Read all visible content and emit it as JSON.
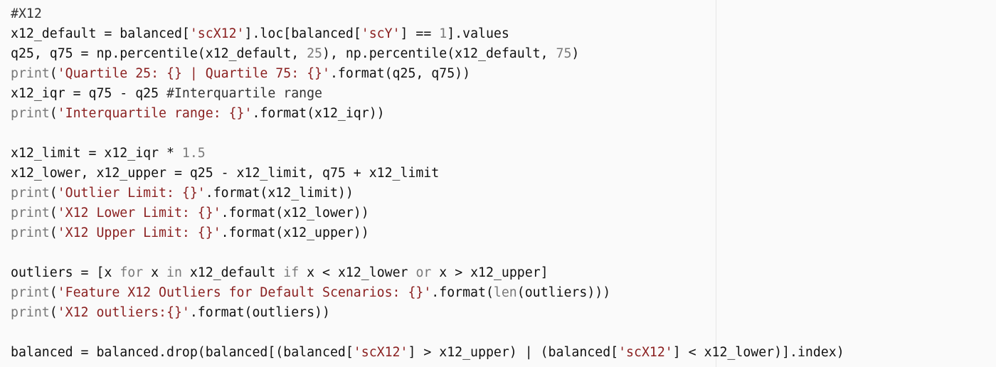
{
  "colors": {
    "background": "#fafafa",
    "plain": "#111111",
    "string": "#8a1f1f",
    "keyword": "#7a7a7a",
    "number": "#7a7a7a",
    "builtin": "#777777",
    "comment": "#333333",
    "ruler": "#e6e6e6"
  },
  "code_lines": [
    [
      {
        "t": "#X12",
        "k": "comment"
      }
    ],
    [
      {
        "t": "x12_default = balanced[",
        "k": "plain"
      },
      {
        "t": "'scX12'",
        "k": "string"
      },
      {
        "t": "].loc[balanced[",
        "k": "plain"
      },
      {
        "t": "'scY'",
        "k": "string"
      },
      {
        "t": "] == ",
        "k": "plain"
      },
      {
        "t": "1",
        "k": "number"
      },
      {
        "t": "].values",
        "k": "plain"
      }
    ],
    [
      {
        "t": "q25, q75 = np.percentile(x12_default, ",
        "k": "plain"
      },
      {
        "t": "25",
        "k": "number"
      },
      {
        "t": "), np.percentile(x12_default, ",
        "k": "plain"
      },
      {
        "t": "75",
        "k": "number"
      },
      {
        "t": ")",
        "k": "plain"
      }
    ],
    [
      {
        "t": "print",
        "k": "builtin"
      },
      {
        "t": "(",
        "k": "plain"
      },
      {
        "t": "'Quartile 25: {} | Quartile 75: {}'",
        "k": "string"
      },
      {
        "t": ".format(q25, q75))",
        "k": "plain"
      }
    ],
    [
      {
        "t": "x12_iqr = q75 - q25 ",
        "k": "plain"
      },
      {
        "t": "#Interquartile range",
        "k": "comment"
      }
    ],
    [
      {
        "t": "print",
        "k": "builtin"
      },
      {
        "t": "(",
        "k": "plain"
      },
      {
        "t": "'Interquartile range: {}'",
        "k": "string"
      },
      {
        "t": ".format(x12_iqr))",
        "k": "plain"
      }
    ],
    [],
    [
      {
        "t": "x12_limit = x12_iqr * ",
        "k": "plain"
      },
      {
        "t": "1.5",
        "k": "number"
      }
    ],
    [
      {
        "t": "x12_lower, x12_upper = q25 - x12_limit, q75 + x12_limit",
        "k": "plain"
      }
    ],
    [
      {
        "t": "print",
        "k": "builtin"
      },
      {
        "t": "(",
        "k": "plain"
      },
      {
        "t": "'Outlier Limit: {}'",
        "k": "string"
      },
      {
        "t": ".format(x12_limit))",
        "k": "plain"
      }
    ],
    [
      {
        "t": "print",
        "k": "builtin"
      },
      {
        "t": "(",
        "k": "plain"
      },
      {
        "t": "'X12 Lower Limit: {}'",
        "k": "string"
      },
      {
        "t": ".format(x12_lower))",
        "k": "plain"
      }
    ],
    [
      {
        "t": "print",
        "k": "builtin"
      },
      {
        "t": "(",
        "k": "plain"
      },
      {
        "t": "'X12 Upper Limit: {}'",
        "k": "string"
      },
      {
        "t": ".format(x12_upper))",
        "k": "plain"
      }
    ],
    [],
    [
      {
        "t": "outliers = [x ",
        "k": "plain"
      },
      {
        "t": "for",
        "k": "keyword"
      },
      {
        "t": " x ",
        "k": "plain"
      },
      {
        "t": "in",
        "k": "keyword"
      },
      {
        "t": " x12_default ",
        "k": "plain"
      },
      {
        "t": "if",
        "k": "keyword"
      },
      {
        "t": " x < x12_lower ",
        "k": "plain"
      },
      {
        "t": "or",
        "k": "keyword"
      },
      {
        "t": " x > x12_upper]",
        "k": "plain"
      }
    ],
    [
      {
        "t": "print",
        "k": "builtin"
      },
      {
        "t": "(",
        "k": "plain"
      },
      {
        "t": "'Feature X12 Outliers for Default Scenarios: {}'",
        "k": "string"
      },
      {
        "t": ".format(",
        "k": "plain"
      },
      {
        "t": "len",
        "k": "builtin"
      },
      {
        "t": "(outliers)))",
        "k": "plain"
      }
    ],
    [
      {
        "t": "print",
        "k": "builtin"
      },
      {
        "t": "(",
        "k": "plain"
      },
      {
        "t": "'X12 outliers:{}'",
        "k": "string"
      },
      {
        "t": ".format(outliers))",
        "k": "plain"
      }
    ],
    [],
    [
      {
        "t": "balanced = balanced.drop(balanced[(balanced[",
        "k": "plain"
      },
      {
        "t": "'scX12'",
        "k": "string"
      },
      {
        "t": "] > x12_upper) | (balanced[",
        "k": "plain"
      },
      {
        "t": "'scX12'",
        "k": "string"
      },
      {
        "t": "] < x12_lower)].index)",
        "k": "plain"
      }
    ]
  ]
}
